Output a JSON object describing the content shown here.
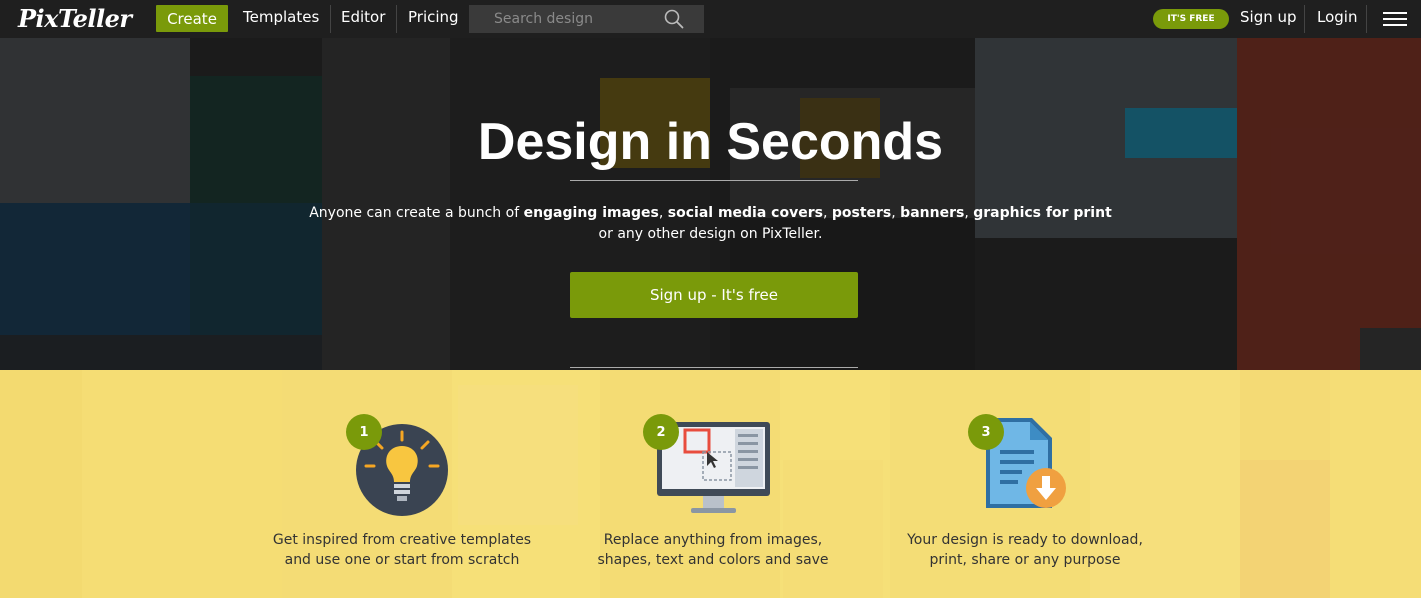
{
  "nav": {
    "logo": "PixTeller",
    "create": "Create",
    "templates": "Templates",
    "editor": "Editor",
    "pricing": "Pricing",
    "search_placeholder": "Search design",
    "badge": "IT'S FREE",
    "signup": "Sign up",
    "login": "Login"
  },
  "hero": {
    "title": "Design in Seconds",
    "sub_1": "Anyone can create a bunch of ",
    "sub_b1": "engaging images",
    "sub_c1": ", ",
    "sub_b2": "social media covers",
    "sub_c2": ", ",
    "sub_b3": "posters",
    "sub_c3": ", ",
    "sub_b4": "banners",
    "sub_c4": ", ",
    "sub_b5": "graphics for print",
    "sub_line2": "or any other design on PixTeller.",
    "cta": "Sign up - It's free"
  },
  "steps": [
    {
      "num": "1",
      "line1": "Get inspired from creative templates",
      "line2": "and use one or start from scratch"
    },
    {
      "num": "2",
      "line1": "Replace anything from images,",
      "line2": "shapes, text and colors and save"
    },
    {
      "num": "3",
      "line1": "Your design is ready to download,",
      "line2": "print, share or any purpose"
    }
  ],
  "colors": {
    "accent": "#7a9a0a",
    "nav_bg": "#1f1f1f",
    "steps_bg": "#f3dd78"
  }
}
